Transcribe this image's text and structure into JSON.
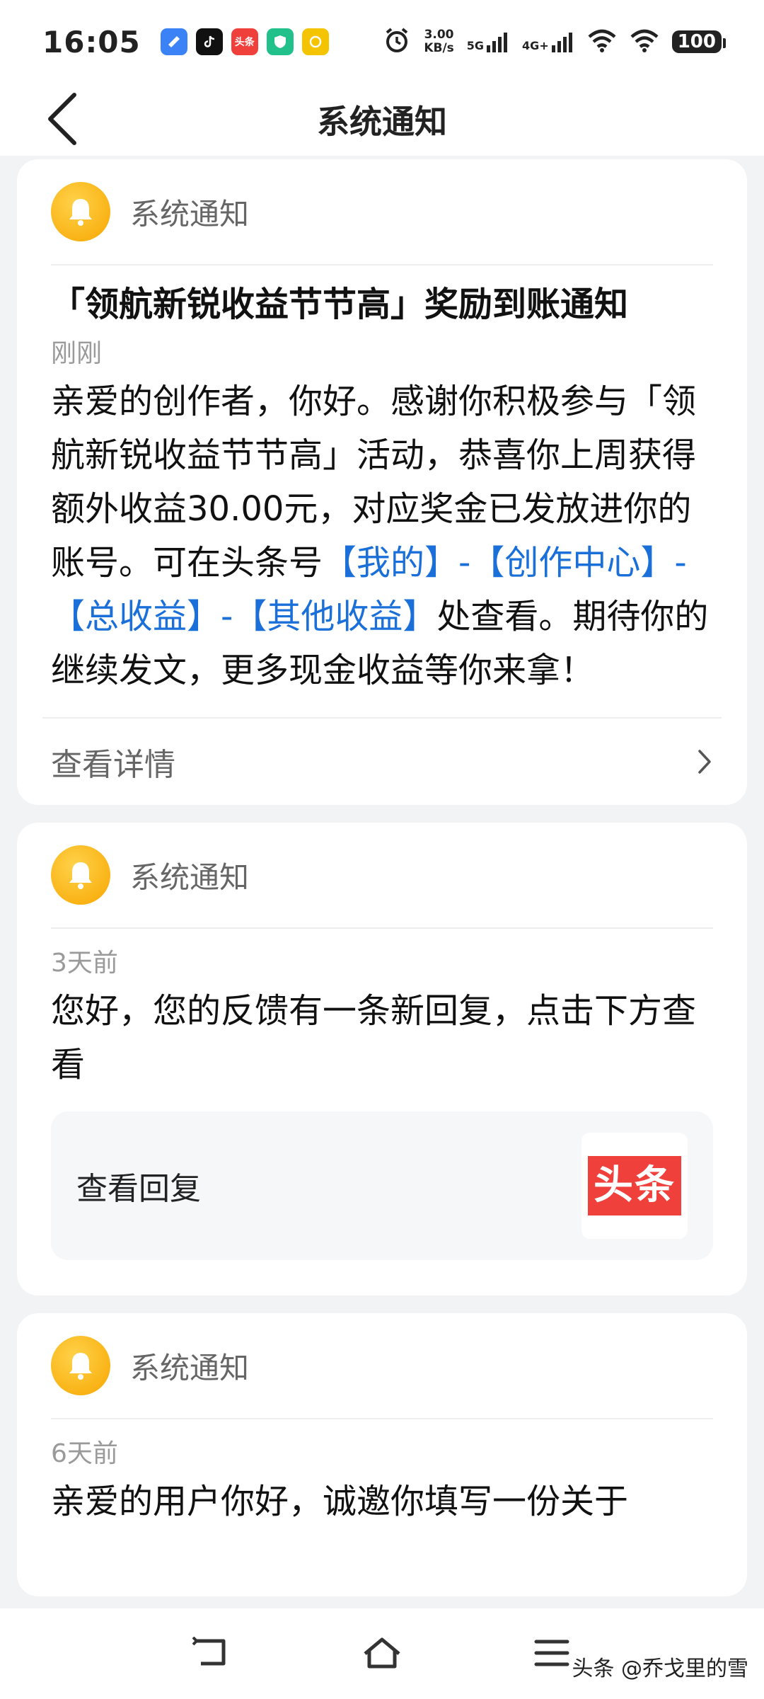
{
  "status_bar": {
    "time": "16:05",
    "app_icons": [
      "mail-icon",
      "tiktok-icon",
      "toutiao-icon",
      "shield-icon",
      "hand-icon"
    ],
    "toutiao_badge": "头条",
    "net_speed_value": "3.00",
    "net_speed_unit": "KB/s",
    "sim1_label": "5G",
    "sim2_label": "4G+",
    "battery": "100"
  },
  "header": {
    "title": "系统通知"
  },
  "notifications": [
    {
      "source": "系统通知",
      "title": "「领航新锐收益节节高」奖励到账通知",
      "time": "刚刚",
      "body_1": "亲爱的创作者，你好。感谢你积极参与「领航新锐收益节节高」活动，恭喜你上周获得额外收益30.00元，对应奖金已发放进你的账号。可在头条号",
      "link_1": "【我的】",
      "sep_1": "-",
      "link_2": "【创作中心】",
      "sep_2": "-",
      "link_3": "【总收益】",
      "sep_3": "-",
      "link_4": "【其他收益】",
      "body_2": "处查看。期待你的继续发文，更多现金收益等你来拿！",
      "footer_label": "查看详情"
    },
    {
      "source": "系统通知",
      "time": "3天前",
      "body": "您好，您的反馈有一条新回复，点击下方查看",
      "reply_label": "查看回复",
      "logo_text": "头条"
    },
    {
      "source": "系统通知",
      "time": "6天前",
      "body": "亲爱的用户你好，诚邀你填写一份关于"
    }
  ],
  "bottom_nav": {
    "watermark": "头条 @乔戈里的雪"
  },
  "colors": {
    "link": "#1a6fd8",
    "bell": "#f7a600",
    "toutiao_red": "#f0403c"
  }
}
